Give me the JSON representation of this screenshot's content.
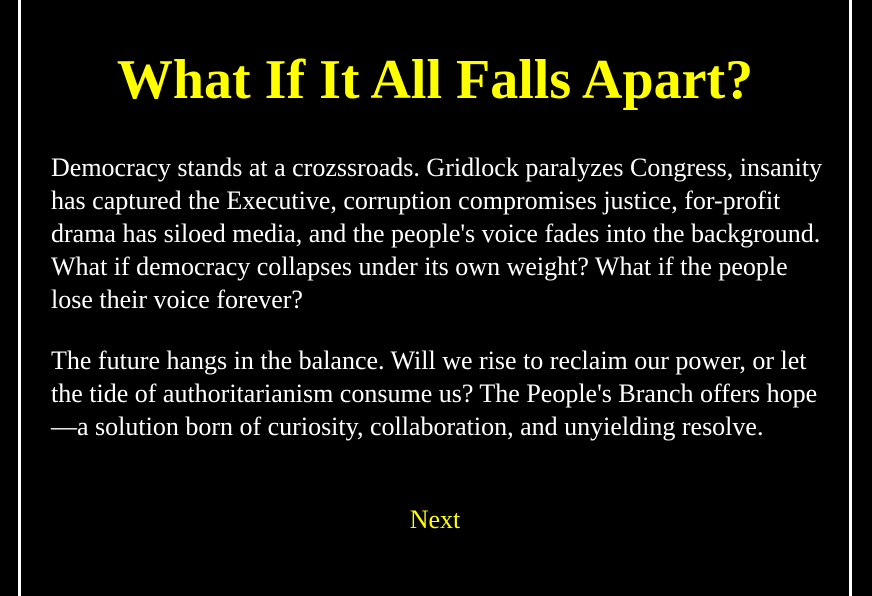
{
  "title": "What If It All Falls Apart?",
  "paragraphs": [
    "Democracy stands at a crozssroads. Gridlock paralyzes Congress, insanity has captured the Executive, corruption compromises justice, for-profit drama has siloed media, and the people's voice fades into the background. What if democracy collapses under its own weight? What if the people lose their voice forever?",
    "The future hangs in the balance. Will we rise to reclaim our power, or let the tide of authoritarianism consume us? The People's Branch offers hope—a solution born of curiosity, collaboration, and unyielding resolve."
  ],
  "next_label": "Next",
  "colors": {
    "accent": "#ffff00",
    "text": "#ffffff",
    "background": "#000000"
  }
}
